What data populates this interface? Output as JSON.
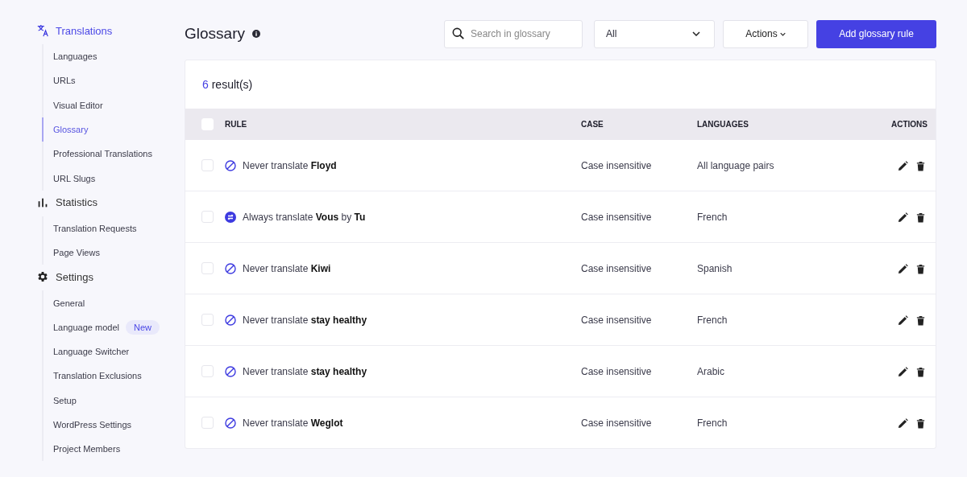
{
  "sidebar": {
    "groups": [
      {
        "kind": "translate",
        "label": "Translations",
        "selected": true,
        "items": [
          {
            "label": "Languages",
            "selected": false
          },
          {
            "label": "URLs",
            "selected": false
          },
          {
            "label": "Visual Editor",
            "selected": false
          },
          {
            "label": "Glossary",
            "selected": true
          },
          {
            "label": "Professional Translations",
            "selected": false
          },
          {
            "label": "URL Slugs",
            "selected": false
          }
        ]
      },
      {
        "kind": "chart",
        "label": "Statistics",
        "selected": false,
        "items": [
          {
            "label": "Translation Requests",
            "selected": false
          },
          {
            "label": "Page Views",
            "selected": false
          }
        ]
      },
      {
        "kind": "gear",
        "label": "Settings",
        "selected": false,
        "items": [
          {
            "label": "General",
            "selected": false
          },
          {
            "label": "Language model",
            "selected": false,
            "badge": "New"
          },
          {
            "label": "Language Switcher",
            "selected": false
          },
          {
            "label": "Translation Exclusions",
            "selected": false
          },
          {
            "label": "Setup",
            "selected": false
          },
          {
            "label": "WordPress Settings",
            "selected": false
          },
          {
            "label": "Project Members",
            "selected": false
          }
        ]
      }
    ]
  },
  "header": {
    "title": "Glossary",
    "search": {
      "placeholder": "Search in glossary"
    },
    "filter": {
      "value": "All"
    },
    "actions_button": "Actions",
    "add_button": "Add glossary rule"
  },
  "results": {
    "count": "6",
    "label": "result(s)"
  },
  "table": {
    "select_all": {
      "checked": false
    },
    "columns": [
      "RULE",
      "CASE",
      "LANGUAGES",
      "ACTIONS"
    ],
    "rows": [
      {
        "checked": false,
        "kind": "never",
        "rule": "Never translate **Floyd**",
        "case": "Case insensitive",
        "languages": "All language pairs"
      },
      {
        "checked": false,
        "kind": "always",
        "rule": "Always translate **Vous** by **Tu**",
        "case": "Case insensitive",
        "languages": "French"
      },
      {
        "checked": false,
        "kind": "never",
        "rule": "Never translate **Kiwi**",
        "case": "Case insensitive",
        "languages": "Spanish"
      },
      {
        "checked": false,
        "kind": "never",
        "rule": "Never translate **stay healthy**",
        "case": "Case insensitive",
        "languages": "French"
      },
      {
        "checked": false,
        "kind": "never",
        "rule": "Never translate **stay healthy**",
        "case": "Case insensitive",
        "languages": "Arabic"
      },
      {
        "checked": false,
        "kind": "never",
        "rule": "Never translate **Weglot**",
        "case": "Case insensitive",
        "languages": "French"
      }
    ]
  }
}
